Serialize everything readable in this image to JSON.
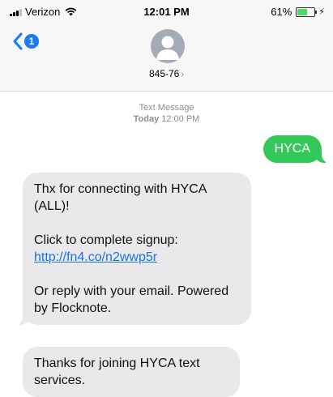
{
  "status_bar": {
    "carrier": "Verizon",
    "time": "12:01 PM",
    "battery_percent_label": "61%",
    "battery_level": 0.61,
    "icons": [
      "signal-icon",
      "wifi-icon",
      "battery-icon",
      "charging-icon"
    ]
  },
  "header": {
    "back_badge": "1",
    "contact": "845-76",
    "contact_chevron": "›"
  },
  "timestamp": {
    "label": "Text Message",
    "day": "Today",
    "time": "12:00 PM"
  },
  "messages": {
    "outgoing_1": "HYCA",
    "incoming_1": {
      "line1": "Thx for connecting with HYCA (ALL)!",
      "line2": "Click to complete signup:",
      "link": "http://fn4.co/n2wwp5r",
      "line3": "Or reply with your email. Powered by Flocknote."
    },
    "incoming_2": "Thanks for joining HYCA text services."
  },
  "colors": {
    "outgoing_bubble": "#34c759",
    "incoming_bubble": "#e9e9eb",
    "accent": "#1a7cf5",
    "link": "#1a73e8"
  }
}
